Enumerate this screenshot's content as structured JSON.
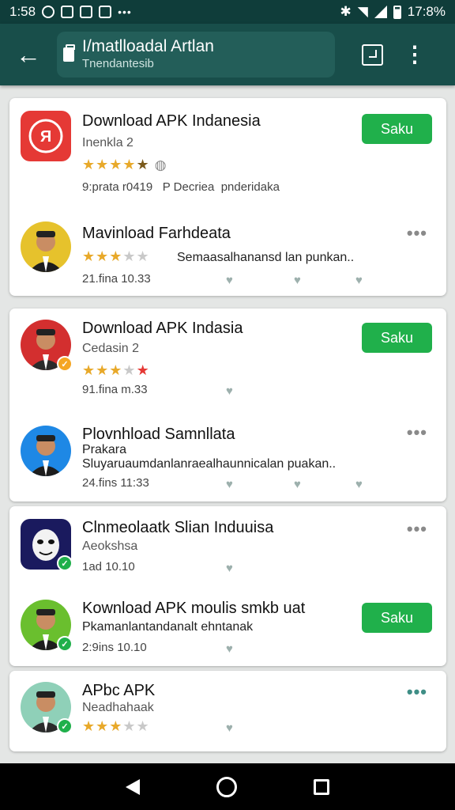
{
  "status_bar": {
    "time": "1:58",
    "battery": "17:8%"
  },
  "app_bar": {
    "title": "I/matlloadal Artlan",
    "subtitle": "Tnendantesib"
  },
  "cards": [
    {
      "items": [
        {
          "name": "Download APK Indanesia",
          "sub": "Inenkla 2",
          "stars": "gold4",
          "meta": "9:prata r0419",
          "meta2": "P Decriea",
          "meta3": "pnderidaka",
          "button": "Saku",
          "avatar": "app-logo"
        },
        {
          "name": "Mavinload Farhdeata",
          "desc": "Semaasalhanansd lan  punkan..",
          "stars": "gold3",
          "meta": "21.fina 10.33",
          "more": true,
          "avatar": "person-yellow"
        }
      ]
    },
    {
      "items": [
        {
          "name": "Download APK Indasia",
          "sub": "Cedasin 2",
          "stars": "mixed",
          "meta": "91.fina m.33",
          "button": "Saku",
          "avatar": "person-red"
        },
        {
          "name": "Plovnhload Samnllata",
          "sub": "Prakara",
          "desc": "Sluyaruaumdanlanraealhaunnicalan  puakan..",
          "meta": "24.fins 11:33",
          "more": true,
          "avatar": "person-blue"
        }
      ]
    },
    {
      "items": [
        {
          "name": "Clnmeolaatk Slian Induuisa",
          "sub": "Aeokshsa",
          "meta": "1ad 10.10",
          "more": true,
          "avatar": "mask"
        },
        {
          "name": "Kownload APK moulis smkb uat",
          "desc": "Pkamanlantandanalt ehntanak",
          "meta": "2:9ins 10.10",
          "button": "Saku",
          "avatar": "person-green"
        }
      ]
    },
    {
      "items": [
        {
          "name": "APbc APK",
          "sub": "Neadhahaak",
          "stars": "gold3",
          "more": true,
          "avatar": "person-teal"
        }
      ]
    }
  ],
  "colors": {
    "app_bar": "#184e4a",
    "status_bar": "#0f3d3a",
    "button": "#20b04b",
    "star": "#e8a92a"
  }
}
